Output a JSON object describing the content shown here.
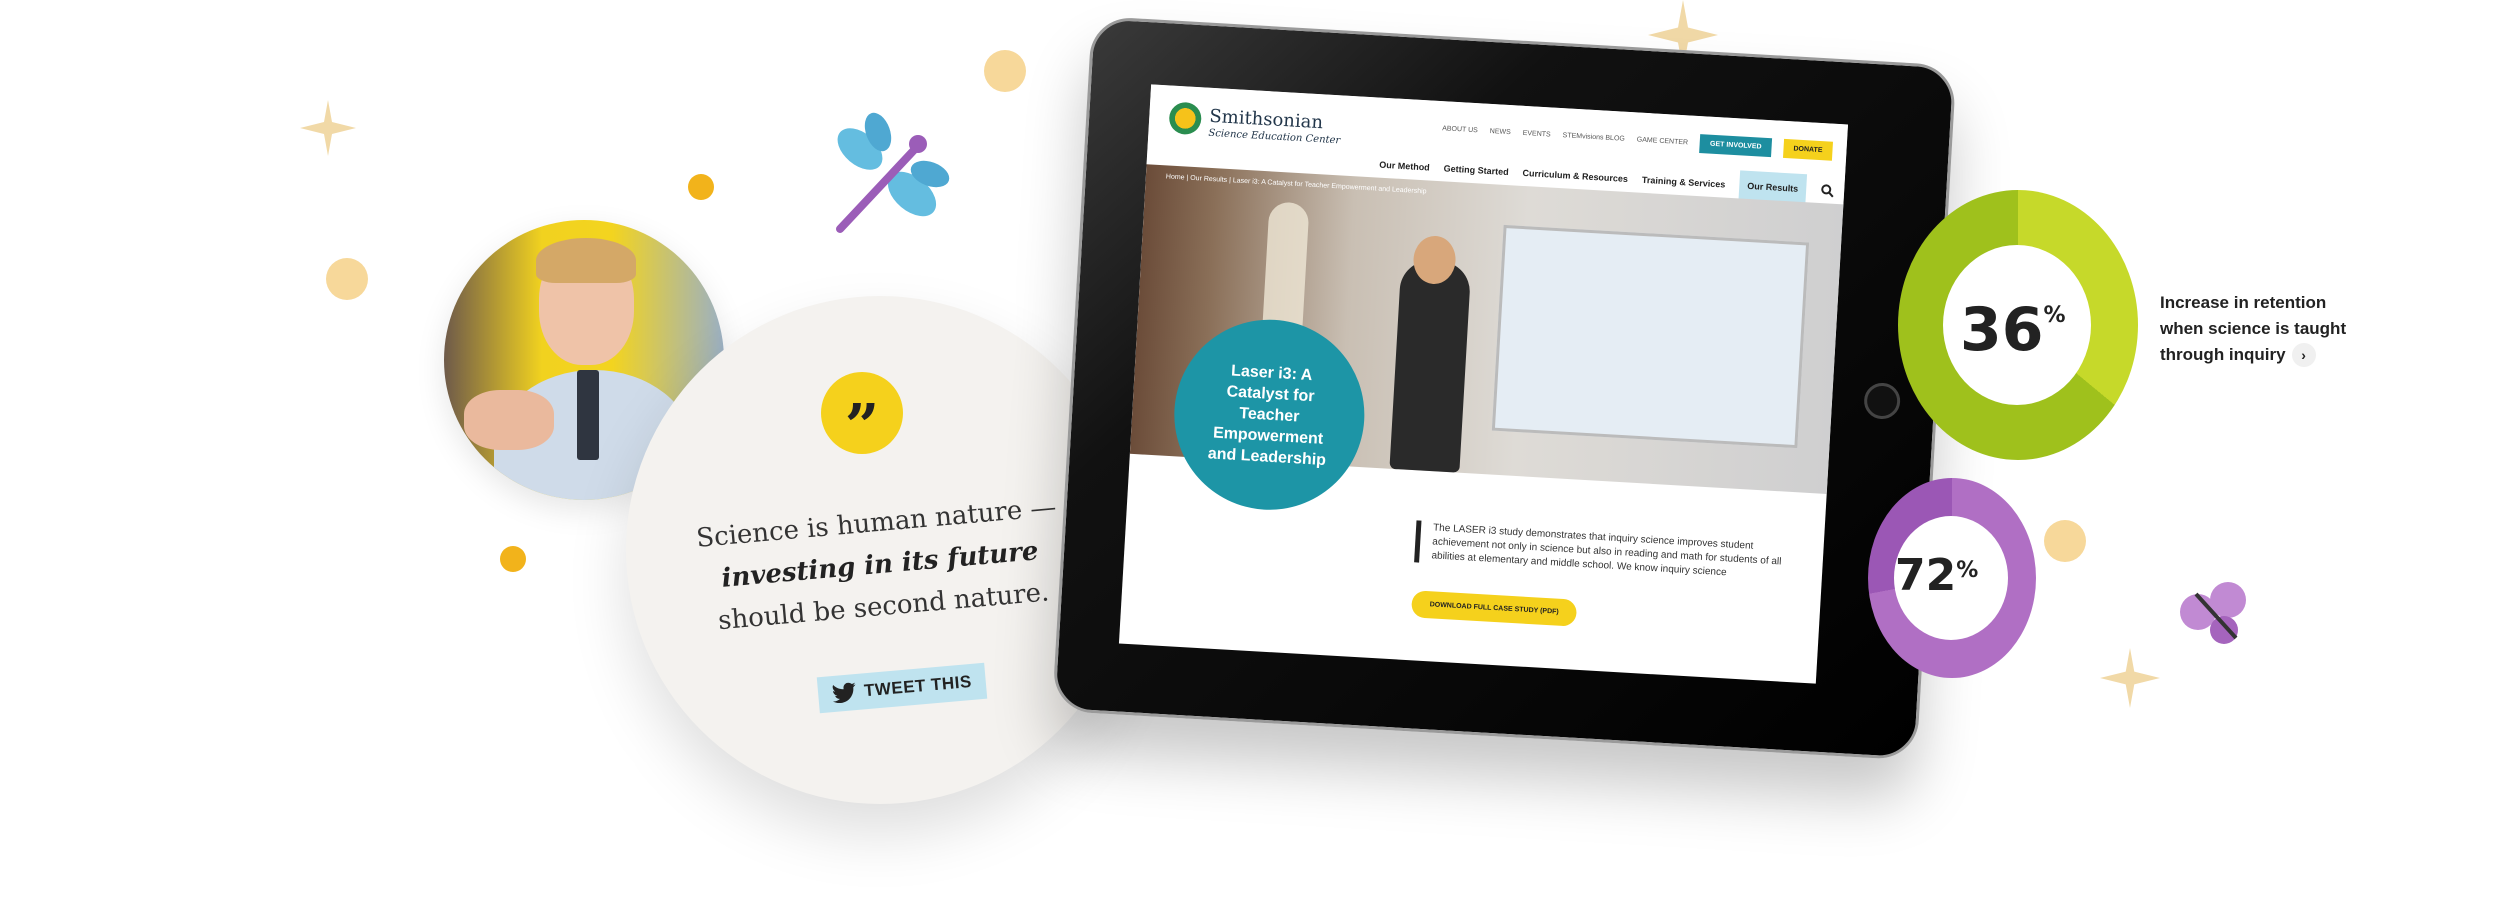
{
  "quote": {
    "line1": "Science is human nature —",
    "line2": "investing in its future",
    "line3": "should be second nature.",
    "tweet_label": "TWEET THIS",
    "quote_glyph": "”"
  },
  "tablet_site": {
    "logo_name": "Smithsonian",
    "logo_sub": "Science Education Center",
    "utility_links": [
      "ABOUT US",
      "NEWS",
      "EVENTS",
      "STEMvisions BLOG",
      "GAME CENTER"
    ],
    "get_involved": "GET INVOLVED",
    "donate": "DONATE",
    "main_nav": [
      "Our Method",
      "Getting Started",
      "Curriculum & Resources",
      "Training & Services",
      "Our Results"
    ],
    "breadcrumb": "Home  |  Our Results  |  Laser i3: A Catalyst for Teacher Empowerment and Leadership",
    "hero_title": "Laser i3: A Catalyst for Teacher Empowerment and Leadership",
    "body_copy": "The LASER i3 study demonstrates that inquiry science improves student achievement not only in science but also in reading and math for students of all abilities at elementary and middle school. We know inquiry science",
    "case_study_button": "DOWNLOAD FULL CASE STUDY (PDF)"
  },
  "stats": {
    "stat1_value": "36",
    "stat1_unit": "%",
    "stat1_text": "Increase in retention when science is taught through inquiry",
    "stat2_value": "72",
    "stat2_unit": "%"
  },
  "icons": {
    "quote": "quote-icon",
    "twitter": "twitter-bird-icon",
    "search": "search-icon",
    "chevron": "chevron-right-icon",
    "dragonfly": "dragonfly-icon",
    "butterfly": "butterfly-icon",
    "sparkle": "sparkle-icon"
  },
  "colors": {
    "yellow": "#f5d11c",
    "teal": "#1d95a6",
    "green": "#a9c71f",
    "purple": "#a564bd",
    "light_blue": "#bfe3ef"
  }
}
